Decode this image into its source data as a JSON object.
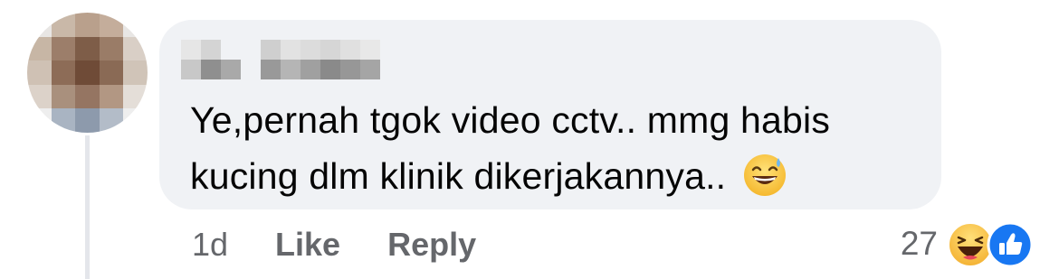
{
  "comment": {
    "text_line1": "Ye,pernah tgok video cctv.. mmg habis",
    "text_line2": "kucing dlm klinik dikerjakannya..",
    "emoji": "sweat-smile-emoji"
  },
  "actions": {
    "time": "1d",
    "like_label": "Like",
    "reply_label": "Reply"
  },
  "reactions": {
    "count": "27",
    "types": [
      "haha-icon",
      "like-icon"
    ]
  },
  "colors": {
    "bubble_bg": "#f0f2f5",
    "text": "#050505",
    "secondary_text": "#65676b",
    "like_blue": "#1877f2",
    "haha_yellow": "#f7c742"
  }
}
